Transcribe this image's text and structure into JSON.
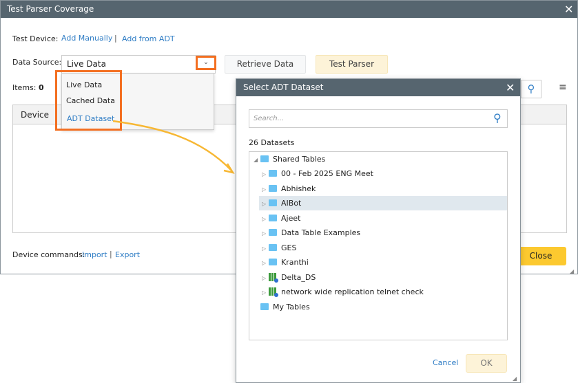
{
  "window": {
    "title": "Test Parser Coverage",
    "close": "✕"
  },
  "test_device": {
    "label": "Test Device:",
    "add_manually": "Add Manually",
    "sep": "|",
    "add_from_adt": "Add from ADT"
  },
  "data_source": {
    "label": "Data Source:",
    "value": "Live Data",
    "options": [
      "Live Data",
      "Cached Data",
      "ADT Dataset"
    ]
  },
  "buttons": {
    "retrieve": "Retrieve Data",
    "test_parser": "Test Parser",
    "close": "Close"
  },
  "items": {
    "label": "Items:",
    "count": "0"
  },
  "table": {
    "headers": [
      "Device"
    ]
  },
  "device_commands": {
    "label": "Device commands:",
    "import": "Import",
    "sep": "|",
    "export": "Export"
  },
  "dialog": {
    "title": "Select ADT Dataset",
    "close": "✕",
    "search_placeholder": "Search...",
    "count": "26 Datasets",
    "tree": {
      "root": "Shared Tables",
      "children": [
        {
          "label": "00 - Feb 2025 ENG Meet",
          "type": "folder"
        },
        {
          "label": "Abhishek",
          "type": "folder"
        },
        {
          "label": "AIBot",
          "type": "folder",
          "selected": true
        },
        {
          "label": "Ajeet",
          "type": "folder"
        },
        {
          "label": "Data Table Examples",
          "type": "folder"
        },
        {
          "label": "GES",
          "type": "folder"
        },
        {
          "label": "Kranthi",
          "type": "folder"
        },
        {
          "label": "Delta_DS",
          "type": "dataset"
        },
        {
          "label": "network wide replication telnet check",
          "type": "dataset"
        }
      ],
      "root2": "My Tables"
    },
    "cancel": "Cancel",
    "ok": "OK"
  },
  "colors": {
    "titlebar": "#56656f",
    "highlight": "#f36f21",
    "arrow": "#f7b733",
    "link": "#2f7dc5",
    "close_btn": "#fcc92f"
  }
}
